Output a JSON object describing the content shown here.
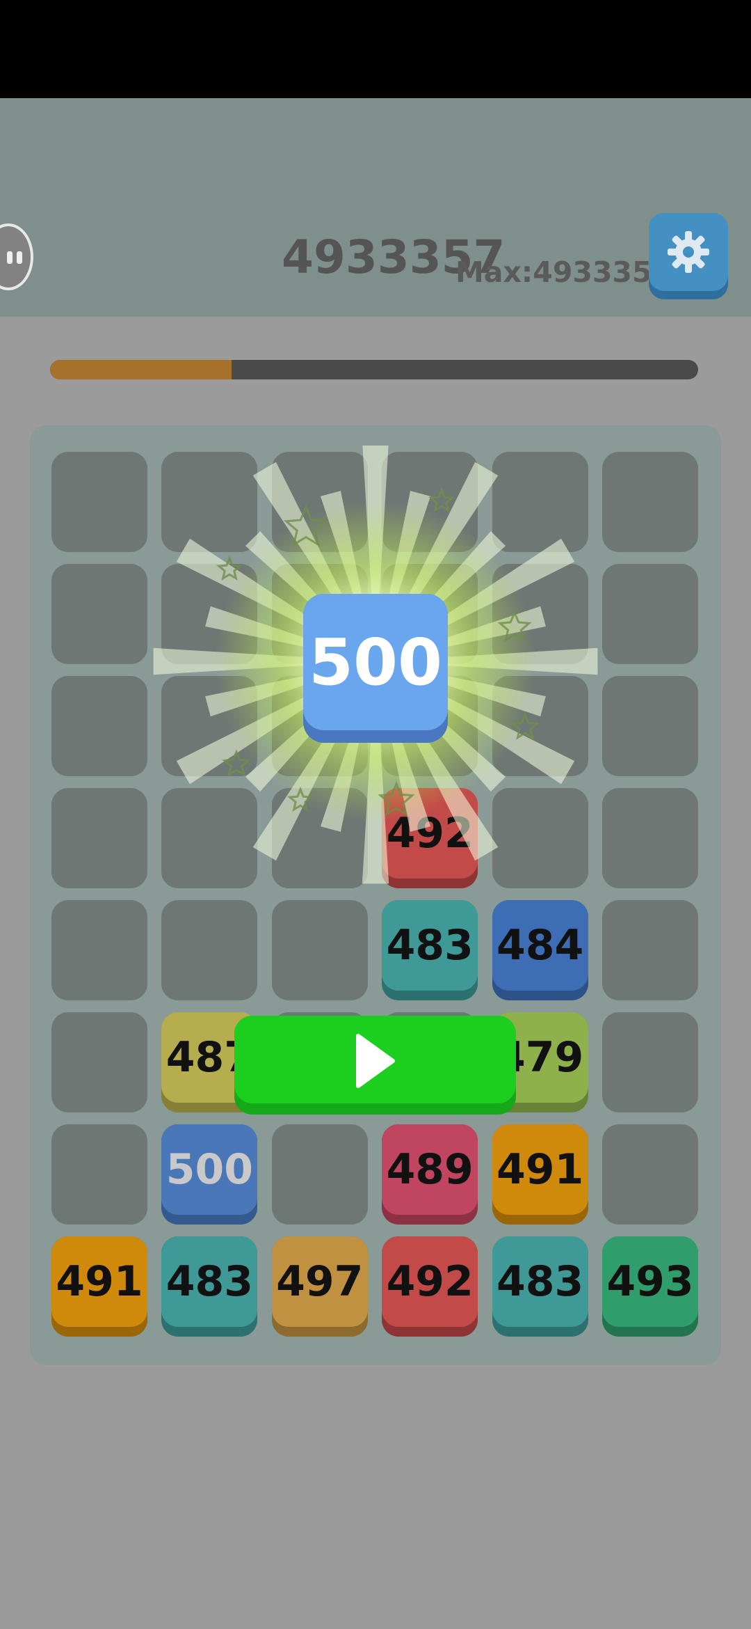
{
  "hud": {
    "score": "4933357",
    "max_score": "Max:4933357",
    "level_progress": 0.28
  },
  "icons": {
    "pause": "pause-icon",
    "settings": "gear-icon",
    "play": "play-icon"
  },
  "colors": {
    "progress_fill": "#a5712b",
    "settings_button": "#4490c2",
    "play_button": "#1ccf1f",
    "new_tile": "#6aa6ee"
  },
  "new_tile": {
    "value": "500"
  },
  "board": {
    "columns": 6,
    "rows": 8,
    "tiles": [
      {
        "row": 3,
        "col": 3,
        "value": "492",
        "color": "#c24a49",
        "shadow": "#8f3434"
      },
      {
        "row": 4,
        "col": 3,
        "value": "483",
        "color": "#3f9a97",
        "shadow": "#2c716f"
      },
      {
        "row": 4,
        "col": 4,
        "value": "484",
        "color": "#3d6eb5",
        "shadow": "#2c5287"
      },
      {
        "row": 5,
        "col": 1,
        "value": "487",
        "color": "#b5ad4e",
        "shadow": "#857f37"
      },
      {
        "row": 5,
        "col": 4,
        "value": "479",
        "color": "#8eb14c",
        "shadow": "#688337"
      },
      {
        "row": 6,
        "col": 1,
        "value": "500",
        "color": "#4a77b8",
        "shadow": "#355a8e",
        "text_color": "#c9c9c9"
      },
      {
        "row": 6,
        "col": 3,
        "value": "489",
        "color": "#c04560",
        "shadow": "#8d3246"
      },
      {
        "row": 6,
        "col": 4,
        "value": "491",
        "color": "#cf8a0c",
        "shadow": "#9a6607"
      },
      {
        "row": 7,
        "col": 0,
        "value": "491",
        "color": "#cf8a0c",
        "shadow": "#9a6607"
      },
      {
        "row": 7,
        "col": 1,
        "value": "483",
        "color": "#3f9a97",
        "shadow": "#2c716f"
      },
      {
        "row": 7,
        "col": 2,
        "value": "497",
        "color": "#bf9140",
        "shadow": "#8d6a2d"
      },
      {
        "row": 7,
        "col": 3,
        "value": "492",
        "color": "#c24a49",
        "shadow": "#8f3434"
      },
      {
        "row": 7,
        "col": 4,
        "value": "483",
        "color": "#3f9a97",
        "shadow": "#2c716f"
      },
      {
        "row": 7,
        "col": 5,
        "value": "493",
        "color": "#2f9e6c",
        "shadow": "#21744f"
      }
    ]
  }
}
